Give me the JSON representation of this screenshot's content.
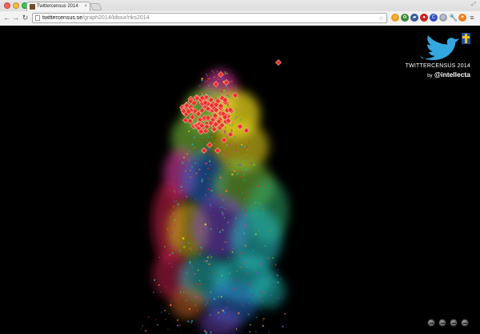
{
  "browser": {
    "tab_title": "Twittercensus 2014",
    "url_host": "twittercensus.se",
    "url_path": "/graph2014/ldtour/riks2014",
    "extensions": [
      {
        "icon": "smiley-extension-icon",
        "color": "#e8a020",
        "glyph": "☺"
      },
      {
        "icon": "recycle-extension-icon",
        "color": "#3a8a3a",
        "glyph": "♻"
      },
      {
        "icon": "bus-extension-icon",
        "color": "#3a5a9a",
        "glyph": "▰"
      },
      {
        "icon": "adblock-extension-icon",
        "color": "#d02020",
        "glyph": "●"
      },
      {
        "icon": "c-extension-icon",
        "color": "#3050c0",
        "glyph": "C"
      },
      {
        "icon": "globe-extension-icon",
        "color": "#9aa2b0",
        "glyph": "◎"
      },
      {
        "icon": "wrench-extension-icon",
        "color": "#666666",
        "glyph": "🔧"
      },
      {
        "icon": "rss-extension-icon",
        "color": "#f08020",
        "glyph": "✶"
      },
      {
        "icon": "menu-icon",
        "color": "#555555",
        "glyph": "≡"
      }
    ]
  },
  "logo": {
    "title": "TWITTERCENSUS 2014",
    "by": "by",
    "handle": "@intellecta",
    "bird_color": "#33a8e0",
    "flag_color": "#f2c21a",
    "flag_bg": "#1a4fa0"
  },
  "visualization": {
    "marker_color": "#e8312a",
    "cluster_colors": [
      "#e8312a",
      "#f07a2a",
      "#e6d21a",
      "#7bc23a",
      "#2fa86a",
      "#25b8b8",
      "#2a6fd0",
      "#7a4ad0",
      "#d23a9a",
      "#c2204a"
    ]
  },
  "controls": [
    {
      "name": "zoom-out-control"
    },
    {
      "name": "zoom-in-control"
    },
    {
      "name": "rotate-control"
    },
    {
      "name": "reset-control"
    }
  ]
}
